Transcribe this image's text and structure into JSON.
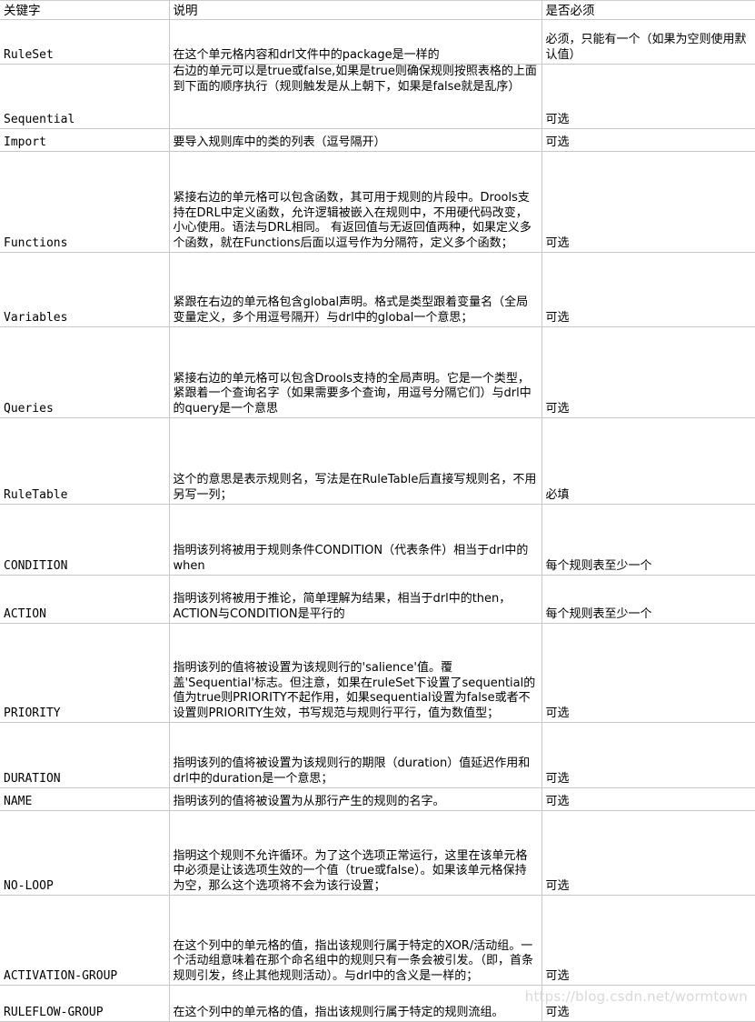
{
  "table": {
    "headers": [
      "关键字",
      "说明",
      "是否必须"
    ],
    "rows": [
      {
        "keyword": "RuleSet",
        "desc": "在这个单元格内容和drl文件中的package是一样的",
        "required": "必须，只能有一个（如果为空则使用默认值）",
        "height": 49,
        "req_align": "top"
      },
      {
        "keyword": "Sequential",
        "desc": "右边的单元可以是true或false,如果是true则确保规则按照表格的上面到下面的顺序执行（规则触发是从上朝下，如果是false就是乱序）",
        "required": "可选",
        "height": 71,
        "desc_align": "top"
      },
      {
        "keyword": "Import",
        "desc": "要导入规则库中的类的列表（逗号隔开）",
        "required": "可选",
        "height": 25
      },
      {
        "keyword": "Functions",
        "desc": "紧接右边的单元格可以包含函数，其可用于规则的片段中。Drools支持在DRL中定义函数，允许逻辑被嵌入在规则中，不用硬代码改变，小心使用。语法与DRL相同。\n有返回值与无返回值两种，如果定义多个函数，就在Functions后面以逗号作为分隔符，定义多个函数；",
        "required": "可选",
        "height": 111
      },
      {
        "keyword": "Variables",
        "desc": "紧跟在右边的单元格包含global声明。格式是类型跟着变量名（全局变量定义，多个用逗号隔开）与drl中的global一个意思；",
        "required": "可选",
        "height": 82
      },
      {
        "keyword": "Queries",
        "desc": "紧接右边的单元格可以包含Drools支持的全局声明。它是一个类型，紧跟着一个查询名字（如果需要多个查询，用逗号分隔它们）与drl中的query是一个意思",
        "required": "可选",
        "height": 100
      },
      {
        "keyword": "RuleTable",
        "desc": "这个的意思是表示规则名，写法是在RuleTable后直接写规则名，不用另写一列；",
        "required": "必填",
        "height": 95
      },
      {
        "keyword": "CONDITION",
        "desc": "指明该列将被用于规则条件CONDITION（代表条件）相当于drl中的when",
        "required": "每个规则表至少一个",
        "height": 78
      },
      {
        "keyword": "ACTION",
        "desc": "指明该列将被用于推论，简单理解为结果，相当于drl中的then，ACTION与CONDITION是平行的",
        "required": "每个规则表至少一个",
        "height": 53
      },
      {
        "keyword": "PRIORITY",
        "desc": "指明该列的值将被设置为该规则行的'salience'值。覆盖'Sequential'标志。但注意，如果在ruleSet下设置了sequential的值为true则PRIORITY不起作用，如果sequential设置为false或者不设置则PRIORITY生效，书写规范与规则行平行，值为数值型；",
        "required": "可选",
        "height": 109
      },
      {
        "keyword": "DURATION",
        "desc": "指明该列的值将被设置为该规则行的期限（duration）值延迟作用和drl中的duration是一个意思；",
        "required": "可选",
        "height": 72
      },
      {
        "keyword": "NAME",
        "desc": "指明该列的值将被设置为从那行产生的规则的名字。",
        "required": "可选",
        "height": 25
      },
      {
        "keyword": "NO-LOOP",
        "desc": "指明这个规则不允许循环。为了这个选项正常运行，这里在该单元格中必须是让该选项生效的一个值（true或false）。如果该单元格保持为空，那么这个选项将不会为该行设置；",
        "required": "可选",
        "height": 93
      },
      {
        "keyword": "ACTIVATION-GROUP",
        "desc": "在这个列中的单元格的值，指出该规则行属于特定的XOR/活动组。一个活动组意味着在那个命名组中的规则只有一条会被引发。（即，首条规则引发，终止其他规则活动）。与drl中的含义是一样的；",
        "required": "可选",
        "height": 99
      },
      {
        "keyword": "RULEFLOW-GROUP",
        "desc": "在这个列中的单元格的值，指出该规则行属于特定的规则流组。",
        "required": "可选",
        "height": 40
      }
    ]
  },
  "watermark": {
    "text": "https://blog.csdn.net/wormtown"
  }
}
